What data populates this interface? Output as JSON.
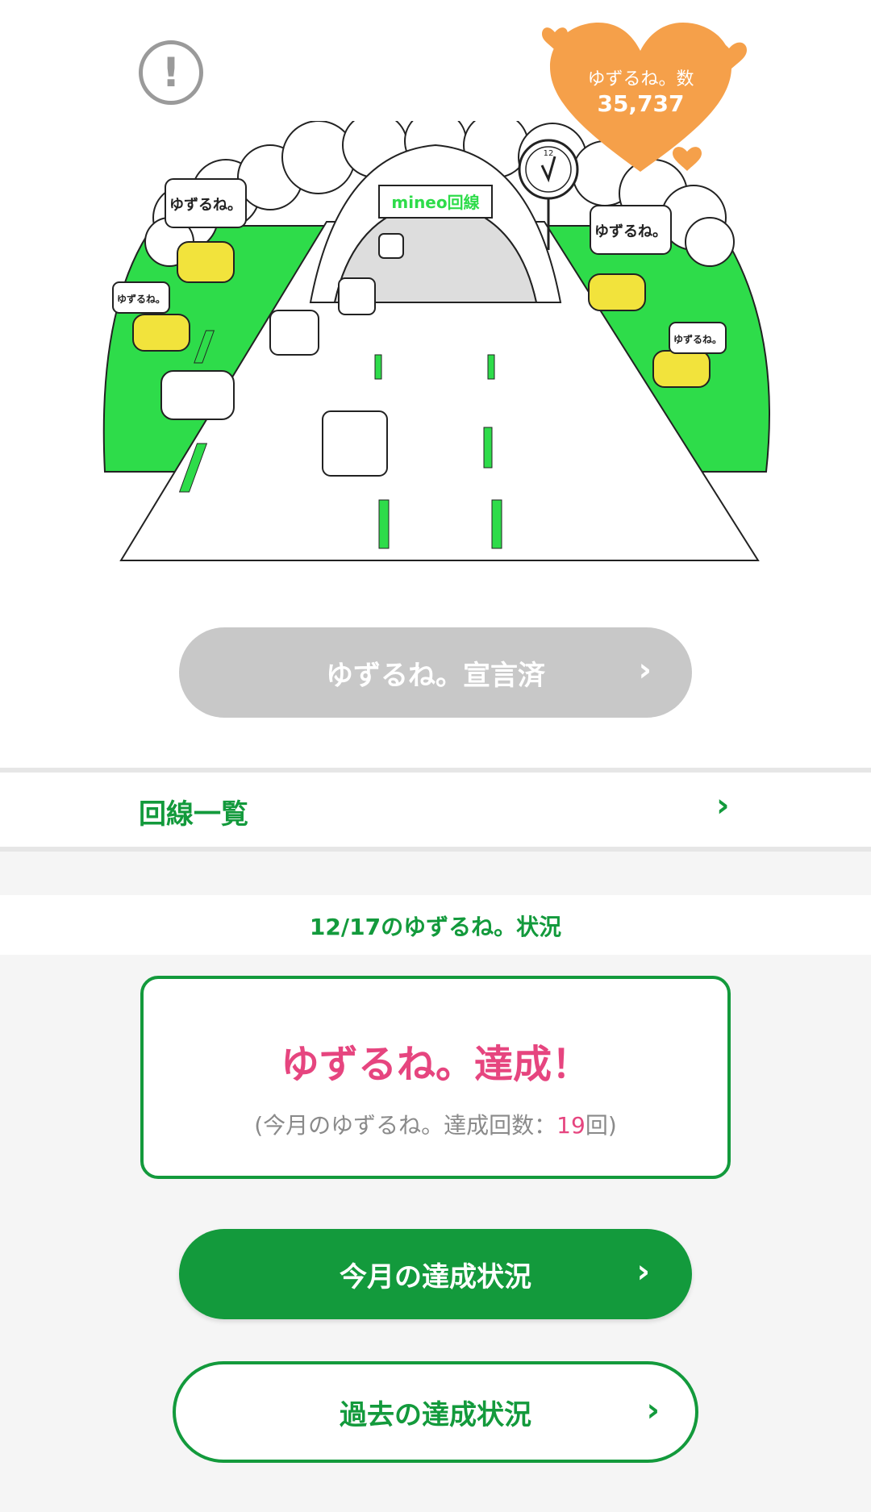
{
  "header": {
    "info_icon": "exclamation-circle-icon",
    "heart_badge": {
      "label": "ゆずるね。数",
      "count": "35,737",
      "color": "#f5a04a"
    }
  },
  "illustration": {
    "sign_text": "mineo回線",
    "bubble_text": "ゆずるね。",
    "clock_number": "12"
  },
  "declare_button": {
    "label": "ゆずるね。宣言済",
    "chevron": "›"
  },
  "line_list": {
    "label": "回線一覧",
    "chevron": "›"
  },
  "status": {
    "header": "12/17のゆずるね。状況",
    "achieved_text": "ゆずるね。達成！",
    "count_prefix": "(今月のゆずるね。達成回数：",
    "count_value": "19",
    "count_suffix": "回)"
  },
  "buttons": {
    "month_label": "今月の達成状況",
    "past_label": "過去の達成状況",
    "chevron": "›"
  },
  "colors": {
    "primary_green": "#139a3c",
    "pink": "#e6457f",
    "disabled_gray": "#c8c8c8",
    "heart_orange": "#f5a04a"
  }
}
